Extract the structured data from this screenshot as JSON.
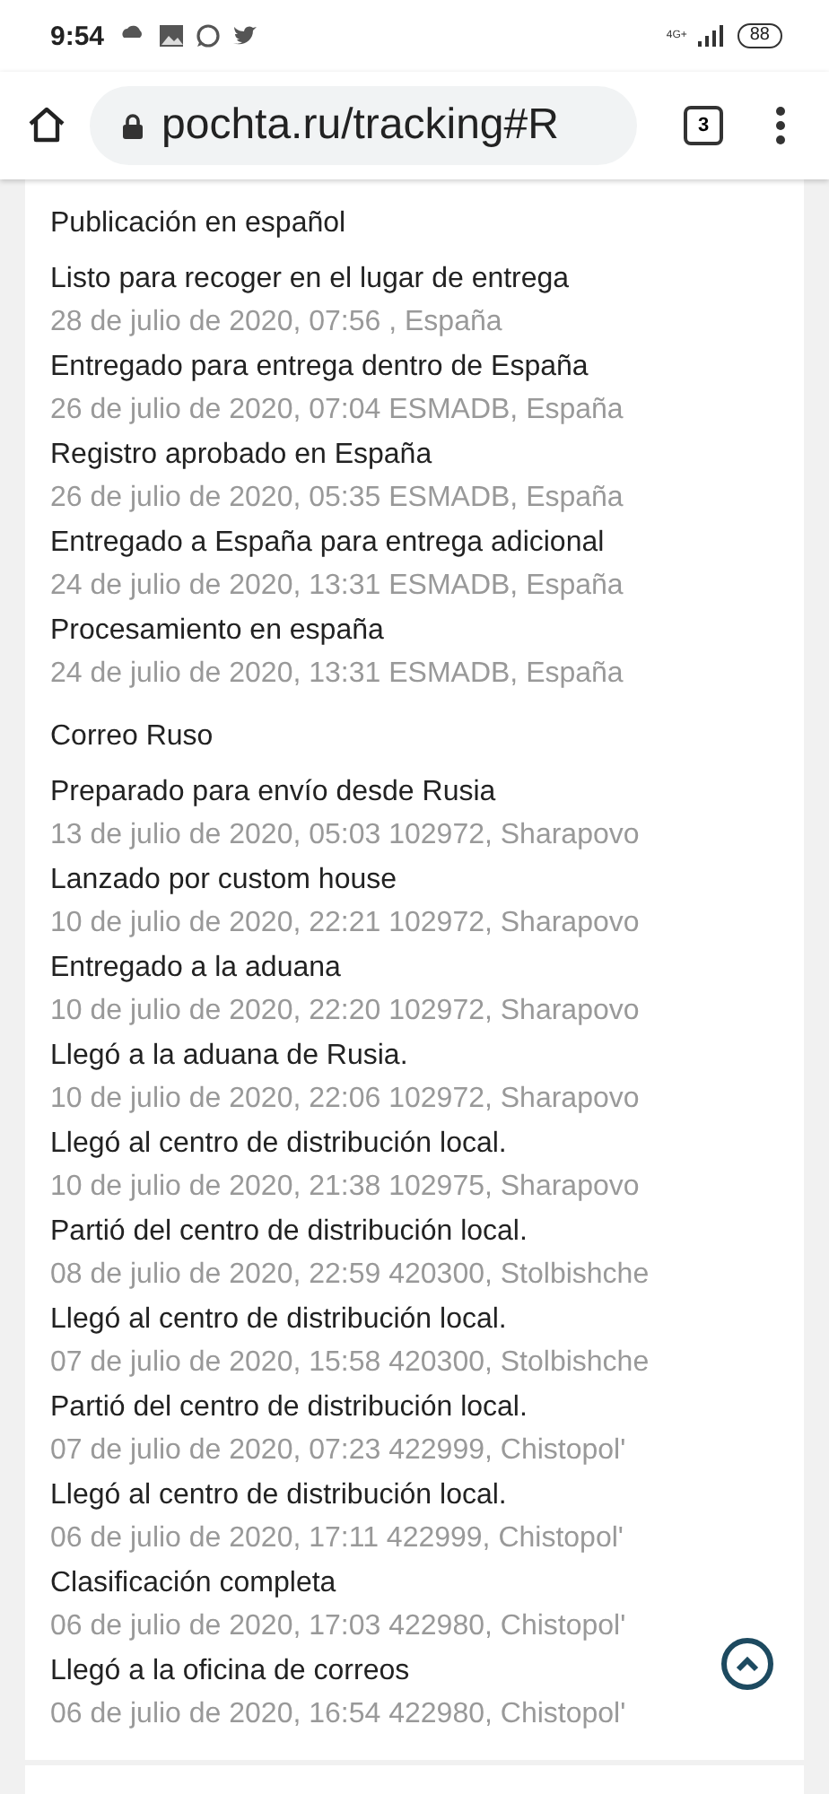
{
  "status_bar": {
    "time": "9:54",
    "network_type": "4G+",
    "battery": "88"
  },
  "browser": {
    "url": "pochta.ru/tracking#R",
    "tab_count": "3"
  },
  "sections": [
    {
      "title": "Publicación en español",
      "events": [
        {
          "status": "Listo para recoger en el lugar de entrega",
          "detail": "28 de julio de 2020, 07:56 , España"
        },
        {
          "status": "Entregado para entrega dentro de España",
          "detail": "26 de julio de 2020, 07:04 ESMADB, España"
        },
        {
          "status": "Registro aprobado en España",
          "detail": "26 de julio de 2020, 05:35 ESMADB, España"
        },
        {
          "status": "Entregado a España para entrega adicional",
          "detail": "24 de julio de 2020, 13:31 ESMADB, España"
        },
        {
          "status": "Procesamiento en españa",
          "detail": "24 de julio de 2020, 13:31 ESMADB, España"
        }
      ]
    },
    {
      "title": "Correo Ruso",
      "events": [
        {
          "status": "Preparado para envío desde Rusia",
          "detail": "13 de julio de 2020, 05:03 102972, Sharapovo"
        },
        {
          "status": "Lanzado por custom house",
          "detail": "10 de julio de 2020, 22:21 102972, Sharapovo"
        },
        {
          "status": "Entregado a la aduana",
          "detail": "10 de julio de 2020, 22:20 102972, Sharapovo"
        },
        {
          "status": "Llegó a la aduana de Rusia.",
          "detail": "10 de julio de 2020, 22:06 102972, Sharapovo"
        },
        {
          "status": "Llegó al centro de distribución local.",
          "detail": "10 de julio de 2020, 21:38 102975, Sharapovo"
        },
        {
          "status": "Partió del centro de distribución local.",
          "detail": "08 de julio de 2020, 22:59 420300, Stolbishche"
        },
        {
          "status": "Llegó al centro de distribución local.",
          "detail": "07 de julio de 2020, 15:58 420300, Stolbishche"
        },
        {
          "status": "Partió del centro de distribución local.",
          "detail": "07 de julio de 2020, 07:23 422999, Chistopolʹ"
        },
        {
          "status": "Llegó al centro de distribución local.",
          "detail": "06 de julio de 2020, 17:11 422999, Chistopolʹ"
        },
        {
          "status": "Clasificación completa",
          "detail": "06 de julio de 2020, 17:03 422980, Chistopolʹ"
        },
        {
          "status": "Llegó a la oficina de correos",
          "detail": "06 de julio de 2020, 16:54 422980, Chistopolʹ"
        }
      ]
    }
  ]
}
